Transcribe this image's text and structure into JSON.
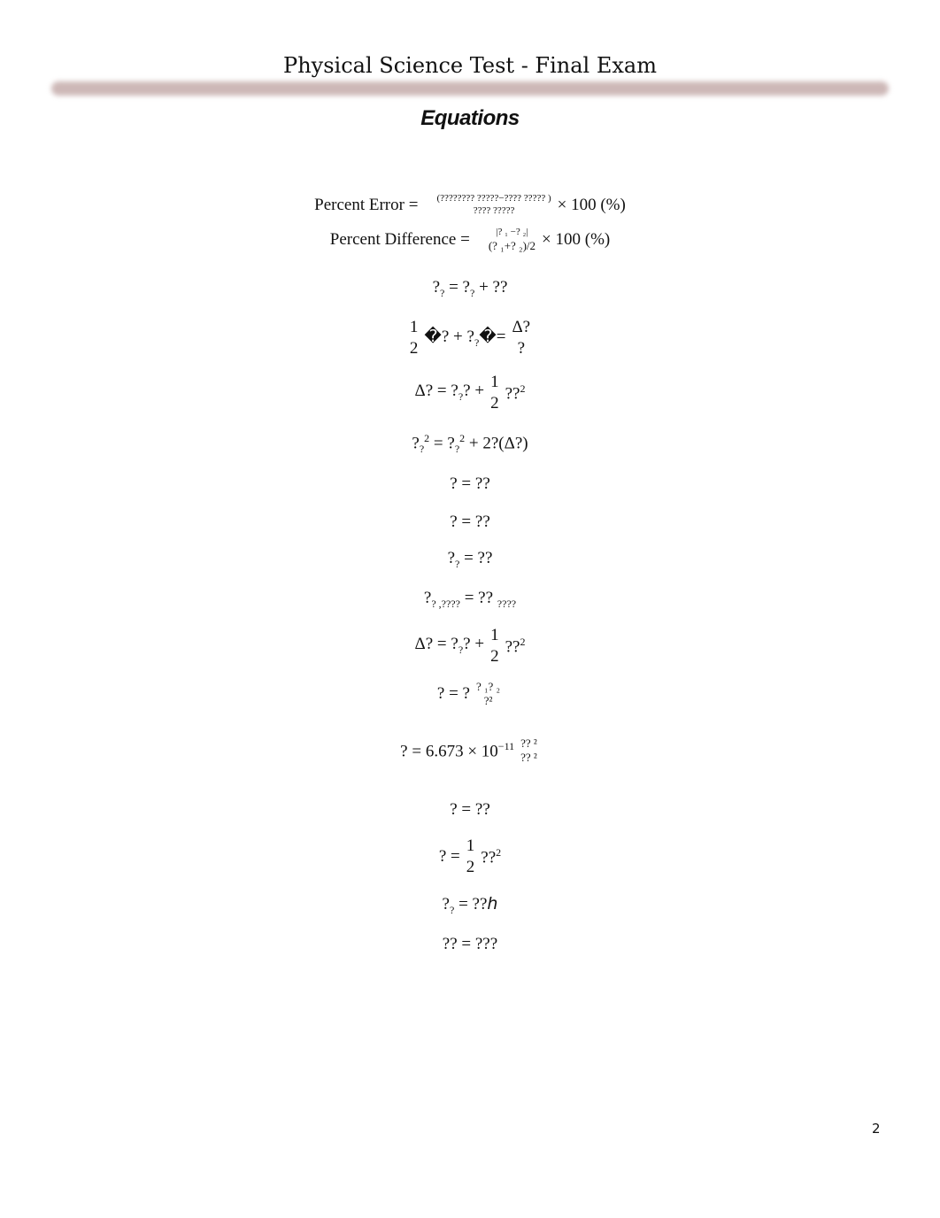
{
  "header": {
    "title": "Physical Science Test - Final Exam",
    "heading": "Equations"
  },
  "percent_error": {
    "label": "Percent Error =",
    "numerator": "(????????    ?????−????    ????? )",
    "denominator": "????  ?????",
    "suffix": "× 100 (%)"
  },
  "percent_difference": {
    "label": "Percent Difference =",
    "numerator": "|? ₁ −? ₂|",
    "denominator": "(? ₁+? ₂)/2",
    "suffix": "× 100 (%)"
  },
  "equations": [
    {
      "id": "eq1",
      "lhs": "?",
      "lhs_sub": "?",
      "mid": "= ?",
      "mid_sub": "?",
      "rhs": "+ ??"
    },
    {
      "id": "eq2",
      "frac_num": "1",
      "frac_den": "2",
      "body": "�? + ?",
      "body_sub": "?",
      "body2": "�=",
      "frac2_num": "Δ?",
      "frac2_den": "?"
    },
    {
      "id": "eq3",
      "lhs": "Δ? = ?",
      "lhs_sub": "?",
      "lhs2": "? +",
      "frac_num": "1",
      "frac_den": "2",
      "rhs": "??",
      "rhs_sup": "2"
    },
    {
      "id": "eq4",
      "lhs": "?",
      "lhs_sub": "?",
      "lhs_sup": "2",
      "mid": "= ?",
      "mid_sub": "?",
      "mid_sup": "2",
      "rhs": "+ 2?(Δ?)"
    },
    {
      "id": "eq5",
      "text": "?  = ??"
    },
    {
      "id": "eq6",
      "text": "? = ??"
    },
    {
      "id": "eq7",
      "lhs": "?",
      "lhs_sub": "?",
      "rhs": " = ??"
    },
    {
      "id": "eq8",
      "lhs": "?",
      "lhs_sub": "? ,????",
      "rhs": "  = ??",
      "rhs_sub": "????"
    },
    {
      "id": "eq9",
      "lhs": "Δ? = ?",
      "lhs_sub": "?",
      "lhs2": "? +",
      "frac_num": "1",
      "frac_den": "2",
      "rhs": "??",
      "rhs_sup": "2"
    },
    {
      "id": "eq10",
      "lhs": "?  = ?",
      "frac_num": "? ₁? ₂",
      "frac_den": "?²"
    },
    {
      "id": "eq11",
      "lhs": "? = 6.673 × 10",
      "lhs_sup": "−11",
      "frac_num": "??  ²",
      "frac_den": "?? ²"
    },
    {
      "id": "eq12",
      "text": "? = ??"
    },
    {
      "id": "eq13",
      "lhs": "?  =",
      "frac_num": "1",
      "frac_den": "2",
      "rhs": "??",
      "rhs_sup": "2"
    },
    {
      "id": "eq14",
      "lhs": "?",
      "lhs_sub": "?",
      "rhs": " = ??",
      "rhs_italic": "h"
    },
    {
      "id": "eq15",
      "text": "??  = ???"
    }
  ],
  "footer": {
    "page_number": "2"
  }
}
